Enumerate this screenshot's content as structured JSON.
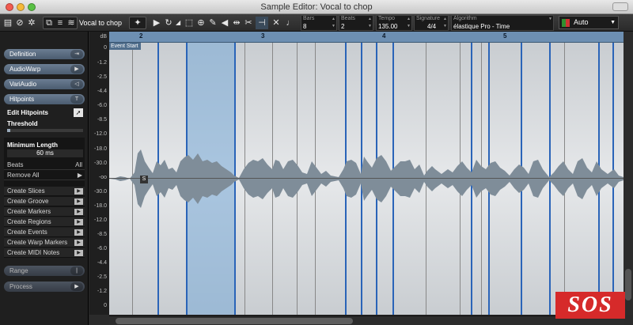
{
  "window": {
    "title": "Sample Editor: Vocal to chop"
  },
  "toolbar": {
    "clip_name": "Vocal to chop",
    "bars": {
      "label": "Bars",
      "value": "8"
    },
    "beats": {
      "label": "Beats",
      "value": "2"
    },
    "tempo": {
      "label": "Tempo",
      "value": "135.00"
    },
    "signature": {
      "label": "Signature",
      "value": "4/4"
    },
    "algorithm": {
      "label": "Algorithm",
      "value": "élastique Pro - Time"
    },
    "musical_mode": "Auto"
  },
  "sidebar": {
    "sections": [
      "Definition",
      "AudioWarp",
      "VariAudio",
      "Hitpoints"
    ],
    "edit_hitpoints": "Edit Hitpoints",
    "threshold_label": "Threshold",
    "min_length_label": "Minimum Length",
    "min_length_value": "60 ms",
    "beats_label": "Beats",
    "beats_value": "All",
    "remove_all": "Remove All",
    "create_actions": [
      "Create Slices",
      "Create Groove",
      "Create Markers",
      "Create Regions",
      "Create Events",
      "Create Warp Markers",
      "Create MIDI Notes"
    ],
    "range": "Range",
    "process": "Process"
  },
  "editor": {
    "db_unit": "dB",
    "db_scale": [
      "0",
      "-1.2",
      "-2.5",
      "-4.4",
      "-6.0",
      "-8.5",
      "-12.0",
      "-18.0",
      "-30.0",
      "-oo",
      "-30.0",
      "-18.0",
      "-12.0",
      "-8.5",
      "-6.0",
      "-4.4",
      "-2.5",
      "-1.2",
      "0"
    ],
    "bars": [
      "2",
      "3",
      "4",
      "5"
    ],
    "event_start": "Event Start",
    "slice_marker": "S"
  },
  "watermark": "SOS"
}
